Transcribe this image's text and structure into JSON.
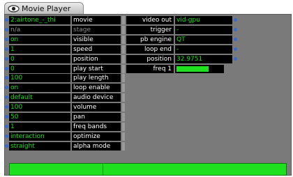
{
  "window": {
    "tab_title": "Movie Player"
  },
  "left_params": [
    {
      "value": "2:airtone_-_thi",
      "label": "movie",
      "dim": false
    },
    {
      "value": "n/a",
      "label": "stage",
      "dim": true
    },
    {
      "value": "on",
      "label": "visible",
      "dim": false
    },
    {
      "value": "1",
      "label": "speed",
      "dim": false
    },
    {
      "value": "0",
      "label": "position",
      "dim": false
    },
    {
      "value": "0",
      "label": "play start",
      "dim": false
    },
    {
      "value": "100",
      "label": "play length",
      "dim": false
    },
    {
      "value": "on",
      "label": "loop enable",
      "dim": false
    },
    {
      "value": "default",
      "label": "audio device",
      "dim": false
    },
    {
      "value": "100",
      "label": "volume",
      "dim": false
    },
    {
      "value": "50",
      "label": "pan",
      "dim": false
    },
    {
      "value": "1",
      "label": "freq bands",
      "dim": false
    },
    {
      "value": "interaction",
      "label": "optimize",
      "dim": false
    },
    {
      "value": "straight",
      "label": "alpha mode",
      "dim": false
    }
  ],
  "right_params": [
    {
      "label": "video out",
      "value": "vid-gpu"
    },
    {
      "label": "trigger",
      "value": "-"
    },
    {
      "label": "pb engine",
      "value": "QT"
    },
    {
      "label": "loop end",
      "value": "-"
    },
    {
      "label": "position",
      "value": "32.9751"
    }
  ],
  "freq1": {
    "label": "freq 1",
    "level": 0.7
  },
  "bottom_bar": {
    "level": 1.0
  },
  "colors": {
    "value_text": "#18e018",
    "label_text": "#ffffff",
    "port_dot": "#3a6cd0",
    "panel_bg": "#7a7a7a"
  },
  "icons": {
    "tab": "eye-icon"
  }
}
